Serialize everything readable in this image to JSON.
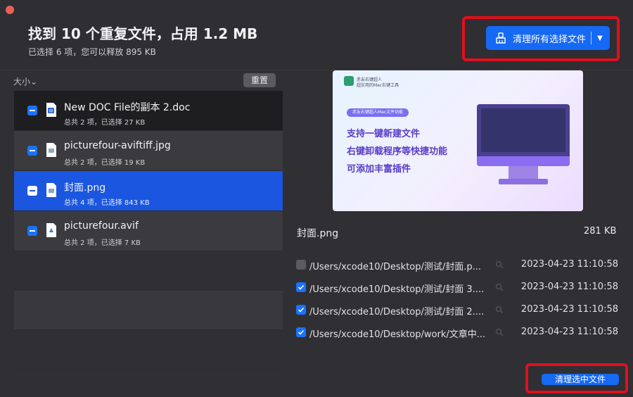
{
  "header": {
    "title": "找到 10 个重复文件，占用 1.2 MB",
    "subtitle": "已选择 6 项，您可以释放 895 KB",
    "clean_all_label": "清理所有选择文件",
    "caret": "▼"
  },
  "sidebar": {
    "sort_label": "大小⌄",
    "reset_label": "重置",
    "items": [
      {
        "name": "New DOC File的副本 2.doc",
        "meta": "总共 2 项，已选择 27 KB"
      },
      {
        "name": "picturefour-aviftiff.jpg",
        "meta": "总共 2 项，已选择 19 KB"
      },
      {
        "name": "封面.png",
        "meta": "总共 4 项，已选择 843 KB"
      },
      {
        "name": "picturefour.avif",
        "meta": "总共 2 项，已选择 7 KB"
      }
    ]
  },
  "preview": {
    "brand_line1": "赤友右键超人",
    "brand_line2": "超实用的Mac右键工具",
    "tag": "赤友右键超人Mac文件功能",
    "lines": [
      "支持一键新建文件",
      "右键卸载程序等快捷功能",
      "可添加丰富插件"
    ]
  },
  "detail": {
    "file_name": "封面.png",
    "file_size": "281 KB",
    "paths": [
      {
        "path": "/Users/xcode10/Desktop/测试/封面.p...",
        "time": "2023-04-23 11:10:58",
        "checked": false
      },
      {
        "path": "/Users/xcode10/Desktop/测试/封面 3....",
        "time": "2023-04-23 11:10:58",
        "checked": true
      },
      {
        "path": "/Users/xcode10/Desktop/测试/封面 2....",
        "time": "2023-04-23 11:10:58",
        "checked": true
      },
      {
        "path": "/Users/xcode10/Desktop/work/文章中...",
        "time": "2023-04-23 11:10:58",
        "checked": true
      }
    ],
    "clean_selected_label": "清理选中文件"
  },
  "colors": {
    "accent": "#1669f3",
    "highlight_box": "#e0101c",
    "selected_row": "#1a56df"
  }
}
